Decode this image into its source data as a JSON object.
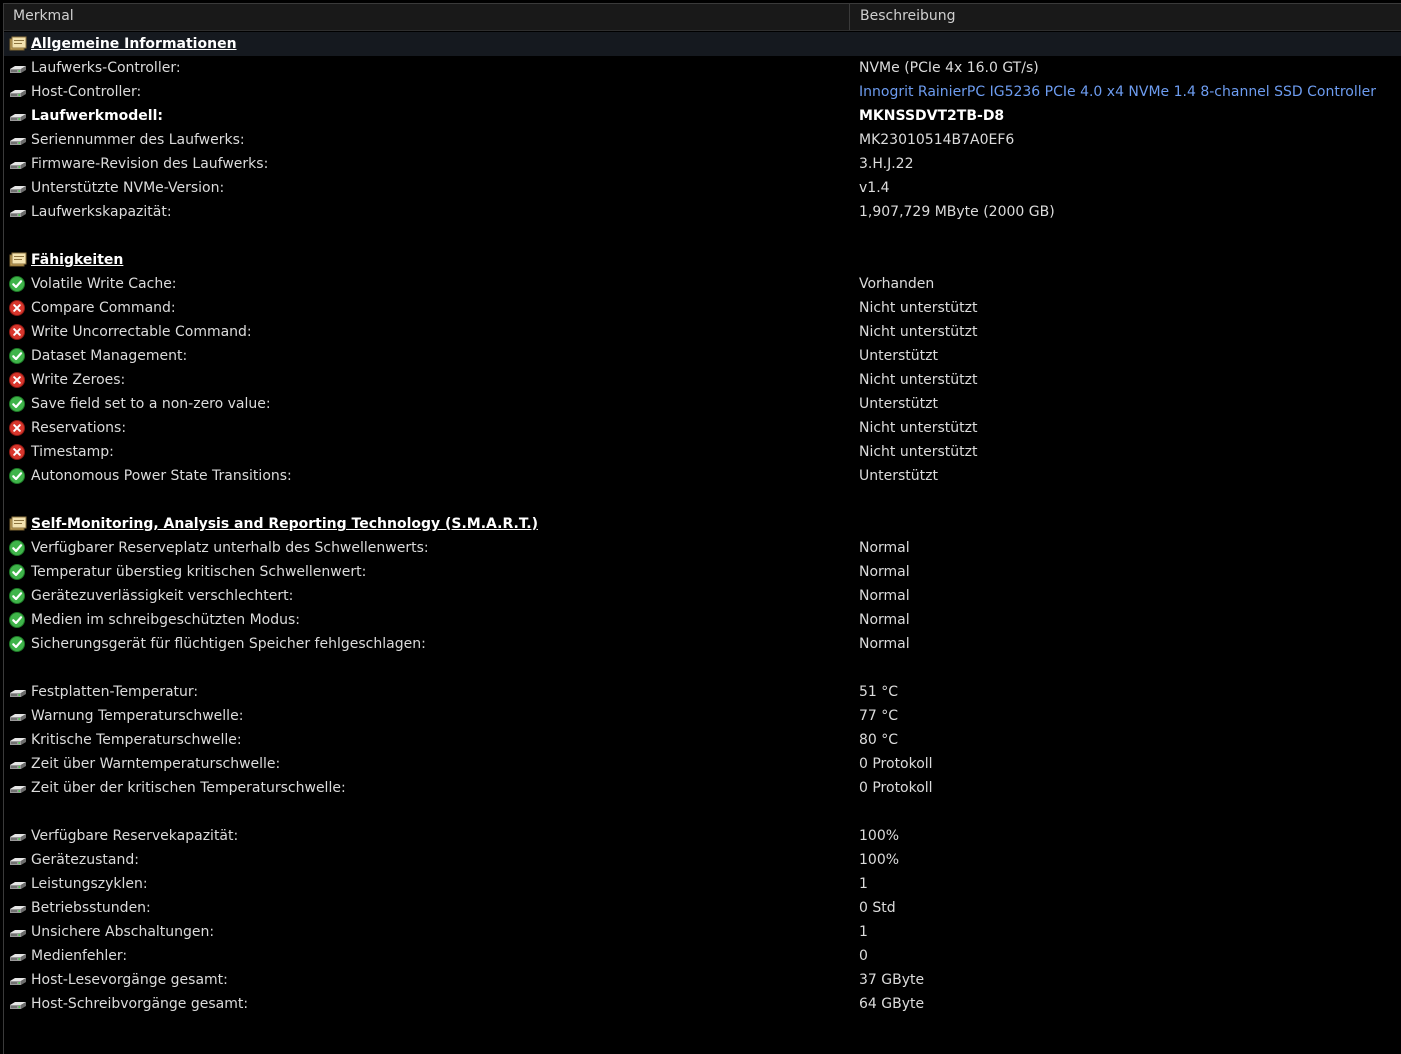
{
  "header": {
    "col1": "Merkmal",
    "col2": "Beschreibung"
  },
  "colors": {
    "link": "#6d9cf0",
    "ok": "#3fb44a",
    "error": "#d8362c"
  },
  "sections": [
    {
      "title": "Allgemeine Informationen",
      "rows": [
        {
          "icon": "drive-icon",
          "label": "Laufwerks-Controller:",
          "value": "NVMe (PCIe 4x 16.0 GT/s)"
        },
        {
          "icon": "drive-icon",
          "label": "Host-Controller:",
          "value": "Innogrit RainierPC IG5236 PCIe 4.0 x4 NVMe 1.4 8-channel SSD Controller",
          "link": true
        },
        {
          "icon": "drive-icon",
          "label": "Laufwerkmodell:",
          "value": "MKNSSDVT2TB-D8",
          "bold": true
        },
        {
          "icon": "drive-icon",
          "label": "Seriennummer des Laufwerks:",
          "value": "MK23010514B7A0EF6"
        },
        {
          "icon": "drive-icon",
          "label": "Firmware-Revision des Laufwerks:",
          "value": "3.H.J.22"
        },
        {
          "icon": "drive-icon",
          "label": "Unterstützte NVMe-Version:",
          "value": "v1.4"
        },
        {
          "icon": "drive-icon",
          "label": "Laufwerkskapazität:",
          "value": "1,907,729 MByte (2000 GB)"
        }
      ]
    },
    {
      "title": "Fähigkeiten",
      "rows": [
        {
          "icon": "check-icon",
          "label": "Volatile Write Cache:",
          "value": "Vorhanden"
        },
        {
          "icon": "error-icon",
          "label": "Compare Command:",
          "value": "Nicht unterstützt"
        },
        {
          "icon": "error-icon",
          "label": "Write Uncorrectable Command:",
          "value": "Nicht unterstützt"
        },
        {
          "icon": "check-icon",
          "label": "Dataset Management:",
          "value": "Unterstützt"
        },
        {
          "icon": "error-icon",
          "label": "Write Zeroes:",
          "value": "Nicht unterstützt"
        },
        {
          "icon": "check-icon",
          "label": "Save field set to a non-zero value:",
          "value": "Unterstützt"
        },
        {
          "icon": "error-icon",
          "label": "Reservations:",
          "value": "Nicht unterstützt"
        },
        {
          "icon": "error-icon",
          "label": "Timestamp:",
          "value": "Nicht unterstützt"
        },
        {
          "icon": "check-icon",
          "label": "Autonomous Power State Transitions:",
          "value": "Unterstützt"
        }
      ]
    },
    {
      "title": "Self-Monitoring, Analysis and Reporting Technology (S.M.A.R.T.)",
      "rows": [
        {
          "icon": "check-icon",
          "label": "Verfügbarer Reserveplatz unterhalb des Schwellenwerts:",
          "value": "Normal"
        },
        {
          "icon": "check-icon",
          "label": "Temperatur überstieg kritischen Schwellenwert:",
          "value": "Normal"
        },
        {
          "icon": "check-icon",
          "label": "Gerätezuverlässigkeit verschlechtert:",
          "value": "Normal"
        },
        {
          "icon": "check-icon",
          "label": "Medien im schreibgeschützten Modus:",
          "value": "Normal"
        },
        {
          "icon": "check-icon",
          "label": "Sicherungsgerät für flüchtigen Speicher fehlgeschlagen:",
          "value": "Normal"
        },
        {
          "spacer": true
        },
        {
          "icon": "drive-icon",
          "label": "Festplatten-Temperatur:",
          "value": "51 °C"
        },
        {
          "icon": "drive-icon",
          "label": "Warnung Temperaturschwelle:",
          "value": "77 °C"
        },
        {
          "icon": "drive-icon",
          "label": "Kritische Temperaturschwelle:",
          "value": "80 °C"
        },
        {
          "icon": "drive-icon",
          "label": "Zeit über Warntemperaturschwelle:",
          "value": "0 Protokoll"
        },
        {
          "icon": "drive-icon",
          "label": "Zeit über der kritischen Temperaturschwelle:",
          "value": "0 Protokoll"
        },
        {
          "spacer": true
        },
        {
          "icon": "drive-icon",
          "label": "Verfügbare Reservekapazität:",
          "value": "100%"
        },
        {
          "icon": "drive-icon",
          "label": "Gerätezustand:",
          "value": "100%"
        },
        {
          "icon": "drive-icon",
          "label": "Leistungszyklen:",
          "value": "1"
        },
        {
          "icon": "drive-icon",
          "label": "Betriebsstunden:",
          "value": "0 Std"
        },
        {
          "icon": "drive-icon",
          "label": "Unsichere Abschaltungen:",
          "value": "1"
        },
        {
          "icon": "drive-icon",
          "label": "Medienfehler:",
          "value": "0"
        },
        {
          "icon": "drive-icon",
          "label": "Host-Lesevorgänge gesamt:",
          "value": "37 GByte"
        },
        {
          "icon": "drive-icon",
          "label": "Host-Schreibvorgänge gesamt:",
          "value": "64 GByte"
        }
      ]
    }
  ]
}
